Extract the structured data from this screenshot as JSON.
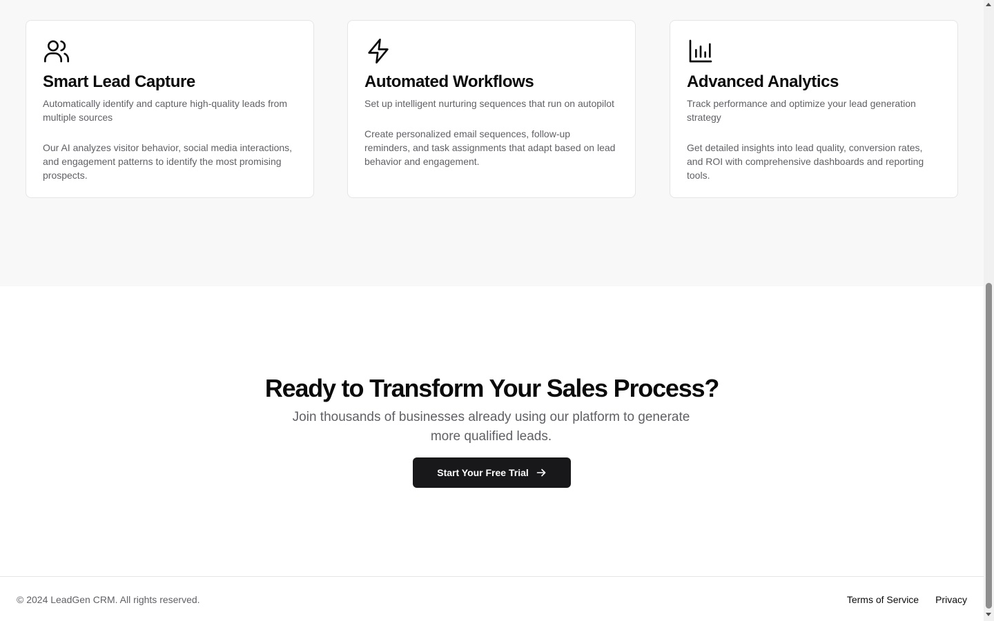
{
  "features": {
    "cards": [
      {
        "icon": "users-icon",
        "title": "Smart Lead Capture",
        "subtitle": "Automatically identify and capture high-quality leads from multiple sources",
        "description": "Our AI analyzes visitor behavior, social media interactions, and engagement patterns to identify the most promising prospects."
      },
      {
        "icon": "lightning-bolt-icon",
        "title": "Automated Workflows",
        "subtitle": "Set up intelligent nurturing sequences that run on autopilot",
        "description": "Create personalized email sequences, follow-up reminders, and task assignments that adapt based on lead behavior and engagement."
      },
      {
        "icon": "bar-chart-icon",
        "title": "Advanced Analytics",
        "subtitle": "Track performance and optimize your lead generation strategy",
        "description": "Get detailed insights into lead quality, conversion rates, and ROI with comprehensive dashboards and reporting tools."
      }
    ]
  },
  "cta": {
    "heading": "Ready to Transform Your Sales Process?",
    "subheading": "Join thousands of businesses already using our platform to generate more qualified leads.",
    "button_label": "Start Your Free Trial",
    "button_icon": "arrow-right-icon"
  },
  "footer": {
    "copyright": "© 2024 LeadGen CRM. All rights reserved.",
    "links": [
      "Terms of Service",
      "Privacy"
    ]
  },
  "colors": {
    "section_bg": "#f8f8f8",
    "button_bg": "#18181b",
    "text_primary": "#0a0a0a",
    "text_muted": "#606066"
  }
}
